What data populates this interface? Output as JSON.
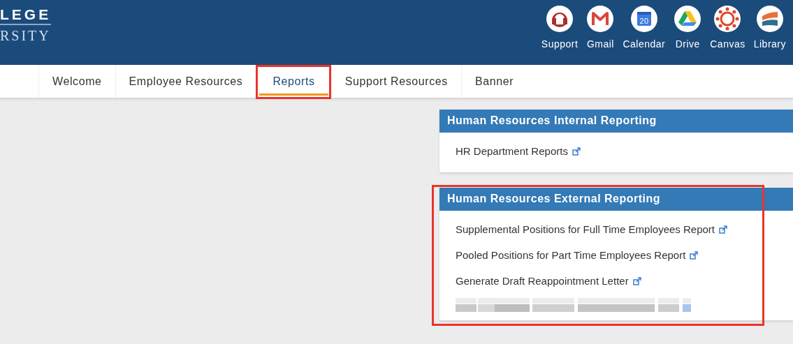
{
  "header": {
    "logo_top": "LEGE",
    "logo_bottom": "RSITY",
    "apps": [
      {
        "kind": "support",
        "label": "Support"
      },
      {
        "kind": "gmail",
        "label": "Gmail"
      },
      {
        "kind": "calendar",
        "label": "Calendar",
        "day": "20"
      },
      {
        "kind": "drive",
        "label": "Drive"
      },
      {
        "kind": "canvas",
        "label": "Canvas"
      },
      {
        "kind": "library",
        "label": "Library"
      }
    ]
  },
  "tabs": [
    {
      "label": "Welcome",
      "selected": false,
      "annotated": false
    },
    {
      "label": "Employee Resources",
      "selected": false,
      "annotated": false
    },
    {
      "label": "Reports",
      "selected": true,
      "annotated": true
    },
    {
      "label": "Support Resources",
      "selected": false,
      "annotated": false
    },
    {
      "label": "Banner",
      "selected": false,
      "annotated": false
    }
  ],
  "panels": [
    {
      "title": "Human Resources Internal Reporting",
      "annotated": false,
      "items": [
        {
          "kind": "link",
          "label": "HR Department Reports"
        }
      ]
    },
    {
      "title": "Human Resources External Reporting",
      "annotated": true,
      "items": [
        {
          "kind": "link",
          "label": "Supplemental Positions for Full Time Employees Report"
        },
        {
          "kind": "link",
          "label": "Pooled Positions for Part Time Employees Report"
        },
        {
          "kind": "link",
          "label": "Generate Draft Reappointment Letter"
        },
        {
          "kind": "redacted"
        }
      ]
    }
  ]
}
